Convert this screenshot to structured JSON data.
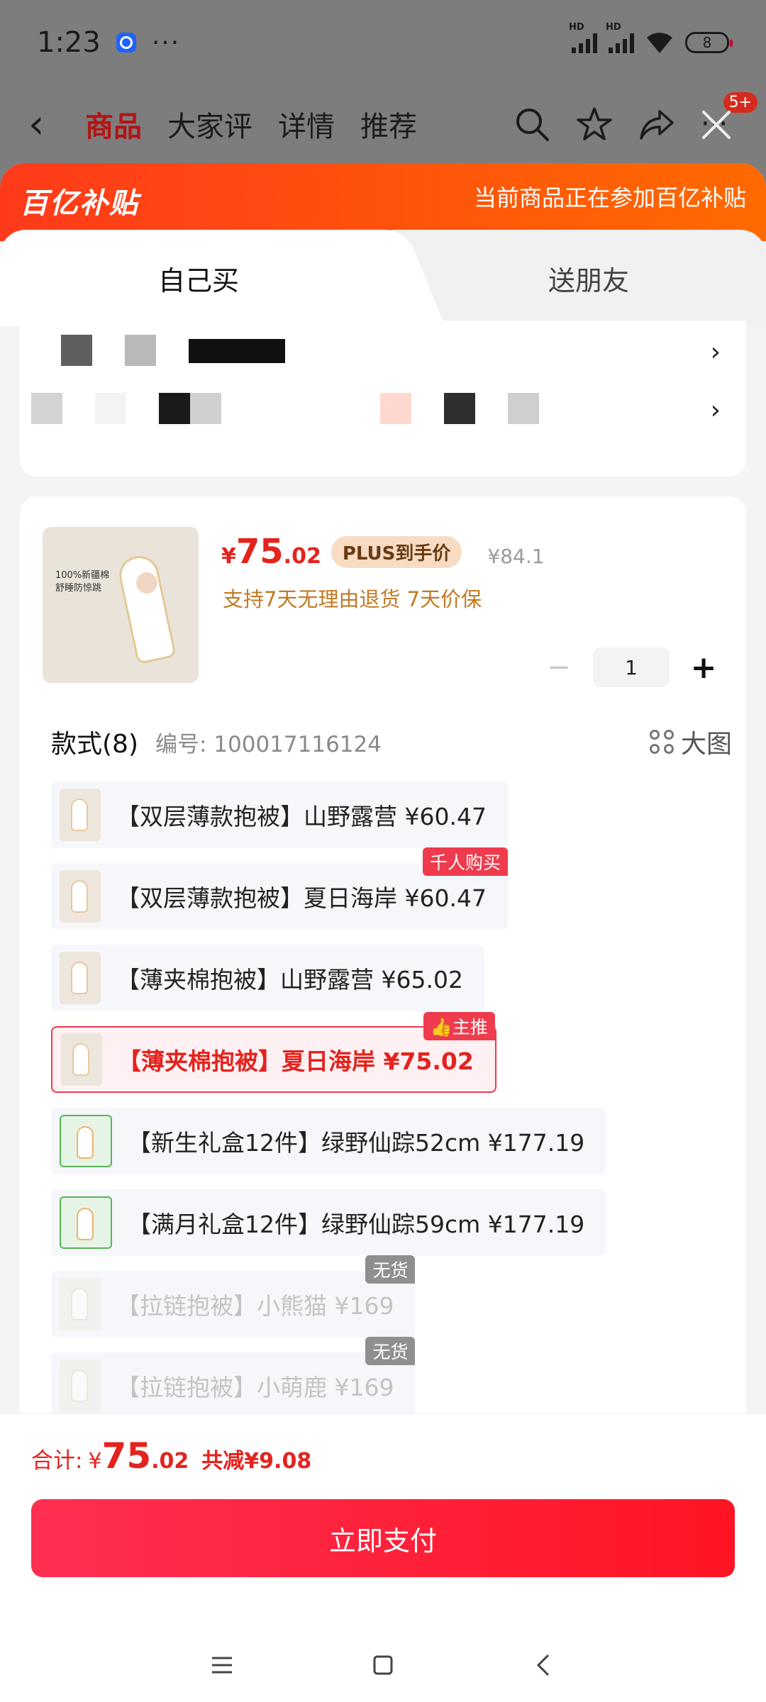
{
  "status_bar": {
    "time": "1:23",
    "more": "···",
    "signal_label_1": "HD",
    "signal_label_2": "HD",
    "battery": "8"
  },
  "nav": {
    "tabs": [
      "商品",
      "大家评",
      "详情",
      "推荐"
    ],
    "active_tab": "商品",
    "message_badge": "5+"
  },
  "banner": {
    "logo": "百亿补贴",
    "note": "当前商品正在参加百亿补贴"
  },
  "buy_tabs": {
    "self": "自己买",
    "friend": "送朋友"
  },
  "address": {
    "chevron": "›"
  },
  "product": {
    "price_symbol": "¥",
    "price_int": "75",
    "price_dec": ".02",
    "plus_tag": "PLUS到手价",
    "original_price": "¥84.1",
    "promise": "支持7天无理由退货  7天价保",
    "quantity": "1",
    "minus_label": "−",
    "plus_label": "+",
    "thumb_caption_1": "100%新疆棉",
    "thumb_caption_2": "舒睡防惊跳"
  },
  "styles": {
    "title": "款式(8)",
    "code": "编号: 100017116124",
    "big_view": "大图",
    "options": [
      {
        "label": "【双层薄款抱被】山野露营  ¥60.47",
        "tag": ""
      },
      {
        "label": "【双层薄款抱被】夏日海岸  ¥60.47",
        "tag": "千人购买"
      },
      {
        "label": "【薄夹棉抱被】山野露营  ¥65.02",
        "tag": ""
      },
      {
        "label": "【薄夹棉抱被】夏日海岸  ¥75.02",
        "tag": "👍主推"
      },
      {
        "label": "【新生礼盒12件】绿野仙踪52cm  ¥177.19",
        "tag": ""
      },
      {
        "label": "【满月礼盒12件】绿野仙踪59cm  ¥177.19",
        "tag": ""
      },
      {
        "label": "【拉链抱被】小熊猫  ¥169",
        "tag": "无货"
      },
      {
        "label": "【拉链抱被】小萌鹿  ¥169",
        "tag": "无货"
      }
    ]
  },
  "footer": {
    "total_label": "合计:",
    "total_symbol": "¥",
    "total_int": "75",
    "total_dec": ".02",
    "saving": "共减¥9.08",
    "pay_button": "立即支付"
  },
  "colors": {
    "accent_red": "#e4231e",
    "banner_orange": "#ff5a10",
    "pay_button": "#ff1f3d"
  }
}
